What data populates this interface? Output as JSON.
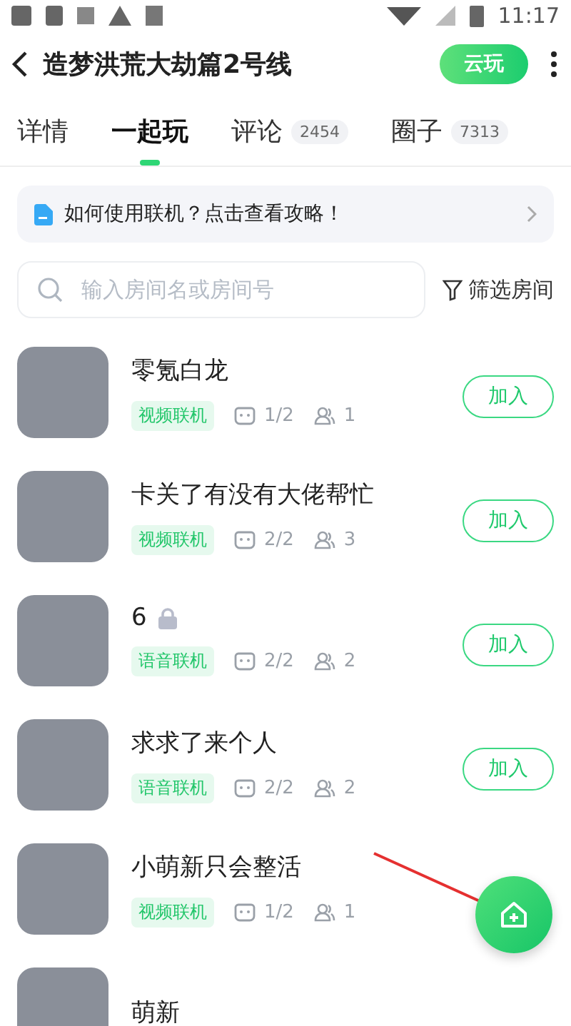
{
  "status_bar": {
    "time": "11:17"
  },
  "header": {
    "title": "造梦洪荒大劫篇2号线",
    "action": "云玩"
  },
  "tabs": [
    {
      "label": "详情",
      "selected": false
    },
    {
      "label": "一起玩",
      "selected": true
    },
    {
      "label": "评论",
      "count": "2454",
      "selected": false
    },
    {
      "label": "圈子",
      "count": "7313",
      "selected": false
    }
  ],
  "tip": {
    "text": "如何使用联机？点击查看攻略！"
  },
  "search": {
    "placeholder": "输入房间名或房间号"
  },
  "filter": {
    "label": "筛选房间"
  },
  "rooms": [
    {
      "name": "零氪白龙",
      "locked": false,
      "mode": "视频联机",
      "slots": "1/2",
      "members": "1",
      "join": "加入"
    },
    {
      "name": "卡关了有没有大佬帮忙",
      "locked": false,
      "mode": "视频联机",
      "slots": "2/2",
      "members": "3",
      "join": "加入"
    },
    {
      "name": "6",
      "locked": true,
      "mode": "语音联机",
      "slots": "2/2",
      "members": "2",
      "join": "加入"
    },
    {
      "name": "求求了来个人",
      "locked": false,
      "mode": "语音联机",
      "slots": "2/2",
      "members": "2",
      "join": "加入"
    },
    {
      "name": "小萌新只会整活",
      "locked": false,
      "mode": "视频联机",
      "slots": "1/2",
      "members": "1"
    },
    {
      "name": "萌新",
      "locked": false
    }
  ]
}
